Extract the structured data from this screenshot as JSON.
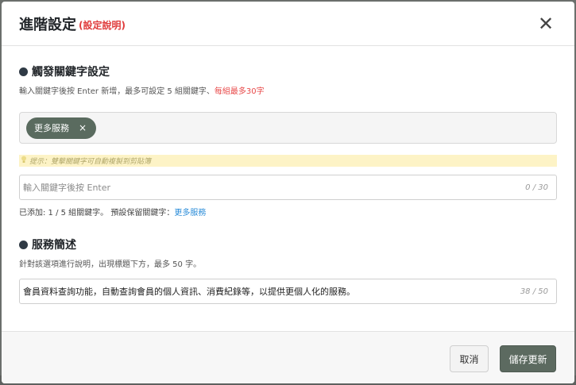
{
  "header": {
    "title": "進階設定",
    "title_link": "(設定說明)",
    "close_symbol": "✕"
  },
  "keywords": {
    "title": "觸發關鍵字設定",
    "hint": "輸入關鍵字後按 Enter 新增，最多可設定 5 組關鍵字、",
    "hint_red": "每組最多30字",
    "tags": [
      "更多服務"
    ],
    "tag_remove_symbol": "×",
    "tip": "提示：雙擊關鍵字可自動複製到剪貼簿",
    "input_placeholder": "輸入關鍵字後按 Enter",
    "input_value": "",
    "input_counter": "0 / 30",
    "added_prefix": "已添加: 1 / 5 組關鍵字。 預設保留關鍵字：",
    "added_link": "更多服務"
  },
  "description": {
    "title": "服務簡述",
    "hint": "針對該選項進行說明，出現標題下方，最多 50 字。",
    "value": "會員資料查詢功能，自動查詢會員的個人資訊、消費紀錄等，以提供更個人化的服務。",
    "counter": "38 / 50"
  },
  "footer": {
    "cancel_label": "取消",
    "save_label": "儲存更新"
  },
  "colors": {
    "accent": "#5c6a60",
    "warning": "#e84a4a",
    "link": "#2a8cd8",
    "tip_bg": "#fdf3c6"
  }
}
